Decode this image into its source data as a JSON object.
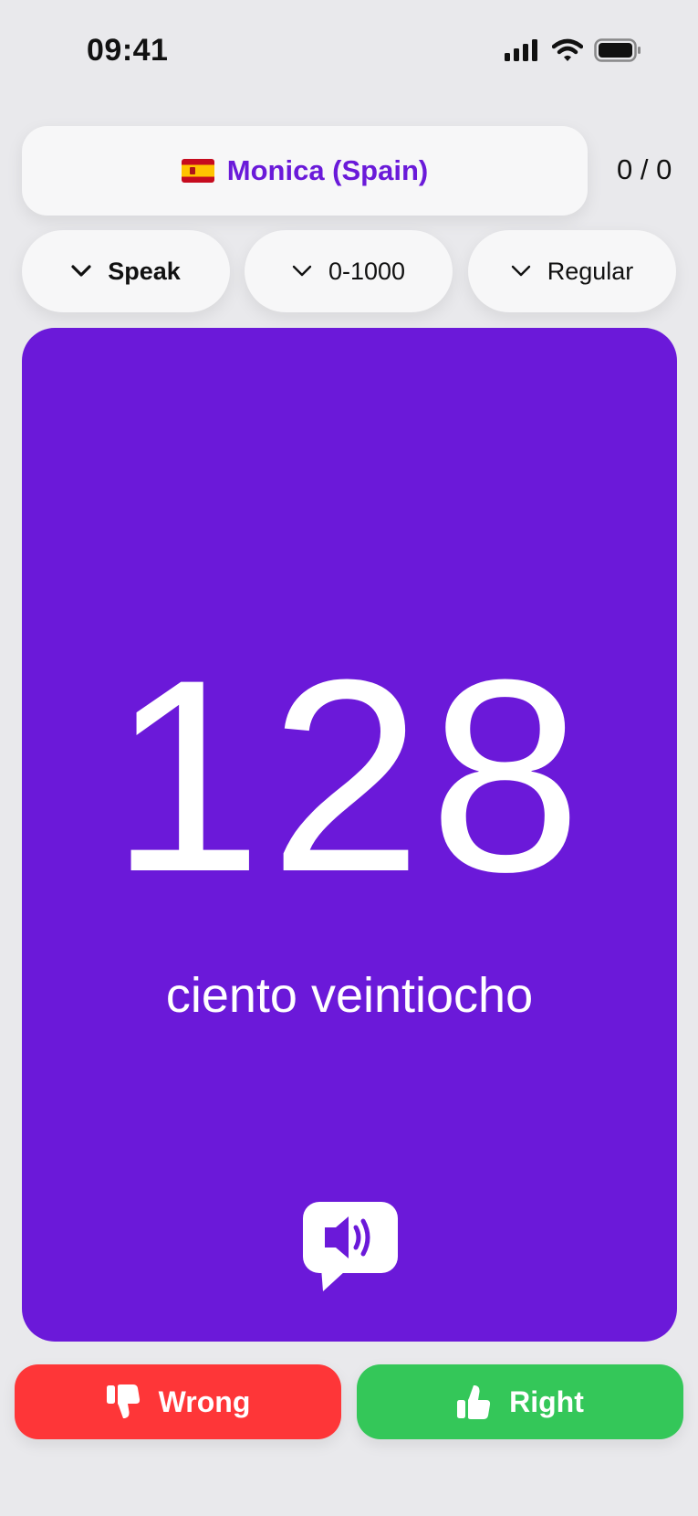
{
  "status_bar": {
    "time": "09:41"
  },
  "header": {
    "voice_flag_icon": "spain-flag-icon",
    "voice_name": "Monica (Spain)",
    "score": "0 / 0"
  },
  "filters": {
    "mode": "Speak",
    "range": "0-1000",
    "style": "Regular",
    "chevron_icon": "chevron-down-icon"
  },
  "card": {
    "number": "128",
    "words": "ciento veintiocho",
    "speaker_icon": "speech-bubble-speaker-icon",
    "background": "#6b19d9"
  },
  "actions": {
    "wrong_label": "Wrong",
    "wrong_icon": "thumbs-down-icon",
    "wrong_color": "#fe3638",
    "right_label": "Right",
    "right_icon": "thumbs-up-icon",
    "right_color": "#34c759"
  }
}
